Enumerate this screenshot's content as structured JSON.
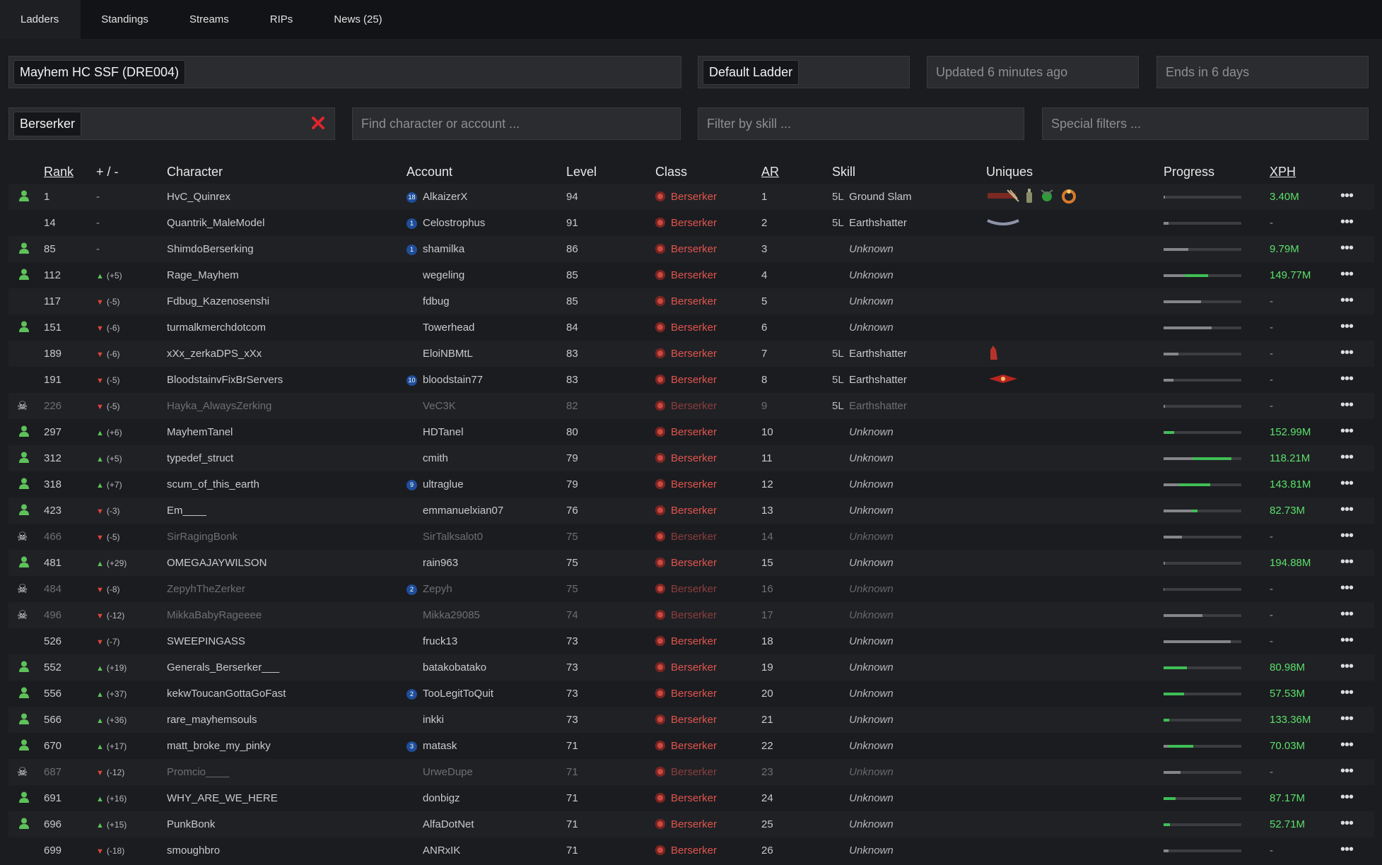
{
  "nav": {
    "tabs": [
      "Ladders",
      "Standings",
      "Streams",
      "RIPs",
      "News (25)"
    ]
  },
  "filters": {
    "league": "Mayhem HC SSF (DRE004)",
    "ladder": "Default Ladder",
    "updated": "Updated 6 minutes ago",
    "ends": "Ends in 6 days",
    "class": "Berserker",
    "search_placeholder": "Find character or account ...",
    "skill_placeholder": "Filter by skill ...",
    "special_placeholder": "Special filters ..."
  },
  "table": {
    "headers": {
      "rank": "Rank",
      "delta": "+ / -",
      "character": "Character",
      "account": "Account",
      "level": "Level",
      "class": "Class",
      "ar": "AR",
      "skill": "Skill",
      "uniques": "Uniques",
      "progress": "Progress",
      "xph": "XPH"
    },
    "rows": [
      {
        "status": "online",
        "rank": "1",
        "dir": "",
        "delta": "-",
        "char": "HvC_Quinrex",
        "charIcon": true,
        "badge": "18",
        "account": "AlkaizerX",
        "level": "94",
        "cls": "Berserker",
        "ar": "1",
        "links": "5L",
        "skill": "Ground Slam",
        "uniques": [
          "belt",
          "flask",
          "amulet",
          "ring"
        ],
        "prev": 0.02,
        "gain": 0.0,
        "xph": "3.40M"
      },
      {
        "status": "",
        "rank": "14",
        "dir": "",
        "delta": "-",
        "char": "Quantrik_MaleModel",
        "charIcon": true,
        "badge": "1",
        "account": "Celostrophus",
        "level": "91",
        "cls": "Berserker",
        "ar": "2",
        "links": "5L",
        "skill": "Earthshatter",
        "uniques": [
          "belt2"
        ],
        "prev": 0.06,
        "gain": 0.0,
        "xph": "-"
      },
      {
        "status": "online",
        "rank": "85",
        "dir": "",
        "delta": "-",
        "char": "ShimdoBerserking",
        "charIcon": false,
        "badge": "1",
        "account": "shamilka",
        "level": "86",
        "cls": "Berserker",
        "ar": "3",
        "links": "",
        "skill": "Unknown",
        "uniques": [],
        "prev": 0.32,
        "gain": 0.0,
        "xph": "9.79M"
      },
      {
        "status": "online",
        "rank": "112",
        "dir": "up",
        "delta": "(+5)",
        "char": "Rage_Mayhem",
        "charIcon": false,
        "badge": "",
        "account": "wegeling",
        "level": "85",
        "cls": "Berserker",
        "ar": "4",
        "links": "",
        "skill": "Unknown",
        "uniques": [],
        "prev": 0.27,
        "gain": 0.3,
        "xph": "149.77M"
      },
      {
        "status": "",
        "rank": "117",
        "dir": "down",
        "delta": "(-5)",
        "char": "Fdbug_Kazenosenshi",
        "charIcon": false,
        "badge": "",
        "account": "fdbug",
        "level": "85",
        "cls": "Berserker",
        "ar": "5",
        "links": "",
        "skill": "Unknown",
        "uniques": [],
        "prev": 0.48,
        "gain": 0.0,
        "xph": "-"
      },
      {
        "status": "online",
        "rank": "151",
        "dir": "down",
        "delta": "(-6)",
        "char": "turmalkmerchdotcom",
        "charIcon": false,
        "badge": "",
        "account": "Towerhead",
        "level": "84",
        "cls": "Berserker",
        "ar": "6",
        "links": "",
        "skill": "Unknown",
        "uniques": [],
        "prev": 0.62,
        "gain": 0.0,
        "xph": "-"
      },
      {
        "status": "",
        "rank": "189",
        "dir": "down",
        "delta": "(-6)",
        "char": "xXx_zerkaDPS_xXx",
        "charIcon": false,
        "badge": "",
        "account": "EloiNBMtL",
        "level": "83",
        "cls": "Berserker",
        "ar": "7",
        "links": "5L",
        "skill": "Earthshatter",
        "uniques": [
          "gloves"
        ],
        "prev": 0.19,
        "gain": 0.0,
        "xph": "-"
      },
      {
        "status": "",
        "rank": "191",
        "dir": "down",
        "delta": "(-5)",
        "char": "BloodstainvFixBrServers",
        "charIcon": false,
        "badge": "10",
        "account": "bloodstain77",
        "level": "83",
        "cls": "Berserker",
        "ar": "8",
        "links": "5L",
        "skill": "Earthshatter",
        "uniques": [
          "belt3"
        ],
        "prev": 0.13,
        "gain": 0.0,
        "xph": "-"
      },
      {
        "status": "dead",
        "rank": "226",
        "dir": "down",
        "delta": "(-5)",
        "char": "Hayka_AlwaysZerking",
        "charIcon": false,
        "badge": "",
        "account": "VeC3K",
        "level": "82",
        "cls": "Berserker",
        "ar": "9",
        "links": "5L",
        "skill": "Earthshatter",
        "uniques": [],
        "prev": 0.02,
        "gain": 0.0,
        "xph": "-"
      },
      {
        "status": "online",
        "rank": "297",
        "dir": "up",
        "delta": "(+6)",
        "char": "MayhemTanel",
        "charIcon": false,
        "badge": "",
        "account": "HDTanel",
        "level": "80",
        "cls": "Berserker",
        "ar": "10",
        "links": "",
        "skill": "Unknown",
        "uniques": [],
        "prev": 0.02,
        "gain": 0.12,
        "xph": "152.99M"
      },
      {
        "status": "online",
        "rank": "312",
        "dir": "up",
        "delta": "(+5)",
        "char": "typedef_struct",
        "charIcon": false,
        "badge": "",
        "account": "cmith",
        "level": "79",
        "cls": "Berserker",
        "ar": "11",
        "links": "",
        "skill": "Unknown",
        "uniques": [],
        "prev": 0.37,
        "gain": 0.5,
        "xph": "118.21M"
      },
      {
        "status": "online",
        "rank": "318",
        "dir": "up",
        "delta": "(+7)",
        "char": "scum_of_this_earth",
        "charIcon": false,
        "badge": "9",
        "account": "ultraglue",
        "level": "79",
        "cls": "Berserker",
        "ar": "12",
        "links": "",
        "skill": "Unknown",
        "uniques": [],
        "prev": 0.2,
        "gain": 0.4,
        "xph": "143.81M"
      },
      {
        "status": "online",
        "rank": "423",
        "dir": "down",
        "delta": "(-3)",
        "char": "Em____",
        "charIcon": false,
        "badge": "",
        "account": "emmanuelxian07",
        "level": "76",
        "cls": "Berserker",
        "ar": "13",
        "links": "",
        "skill": "Unknown",
        "uniques": [],
        "prev": 0.36,
        "gain": 0.08,
        "xph": "82.73M"
      },
      {
        "status": "dead",
        "rank": "466",
        "dir": "down",
        "delta": "(-5)",
        "char": "SirRagingBonk",
        "charIcon": false,
        "badge": "",
        "account": "SirTalksalot0",
        "level": "75",
        "cls": "Berserker",
        "ar": "14",
        "links": "",
        "skill": "Unknown",
        "uniques": [],
        "prev": 0.24,
        "gain": 0.0,
        "xph": "-"
      },
      {
        "status": "online",
        "rank": "481",
        "dir": "up",
        "delta": "(+29)",
        "char": "OMEGAJAYWILSON",
        "charIcon": false,
        "badge": "",
        "account": "rain963",
        "level": "75",
        "cls": "Berserker",
        "ar": "15",
        "links": "",
        "skill": "Unknown",
        "uniques": [],
        "prev": 0.02,
        "gain": 0.0,
        "xph": "194.88M"
      },
      {
        "status": "dead",
        "rank": "484",
        "dir": "down",
        "delta": "(-8)",
        "char": "ZepyhTheZerker",
        "charIcon": false,
        "badge": "2",
        "account": "Zepyh",
        "level": "75",
        "cls": "Berserker",
        "ar": "16",
        "links": "",
        "skill": "Unknown",
        "uniques": [],
        "prev": 0.0,
        "gain": 0.0,
        "xph": "-"
      },
      {
        "status": "dead",
        "rank": "496",
        "dir": "down",
        "delta": "(-12)",
        "char": "MikkaBabyRageeee",
        "charIcon": false,
        "badge": "",
        "account": "Mikka29085",
        "level": "74",
        "cls": "Berserker",
        "ar": "17",
        "links": "",
        "skill": "Unknown",
        "uniques": [],
        "prev": 0.5,
        "gain": 0.0,
        "xph": "-"
      },
      {
        "status": "",
        "rank": "526",
        "dir": "down",
        "delta": "(-7)",
        "char": "SWEEPINGASS",
        "charIcon": false,
        "badge": "",
        "account": "fruck13",
        "level": "73",
        "cls": "Berserker",
        "ar": "18",
        "links": "",
        "skill": "Unknown",
        "uniques": [],
        "prev": 0.86,
        "gain": 0.0,
        "xph": "-"
      },
      {
        "status": "online",
        "rank": "552",
        "dir": "up",
        "delta": "(+19)",
        "char": "Generals_Berserker___",
        "charIcon": false,
        "badge": "",
        "account": "batakobatako",
        "level": "73",
        "cls": "Berserker",
        "ar": "19",
        "links": "",
        "skill": "Unknown",
        "uniques": [],
        "prev": 0.0,
        "gain": 0.3,
        "xph": "80.98M"
      },
      {
        "status": "online",
        "rank": "556",
        "dir": "up",
        "delta": "(+37)",
        "char": "kekwToucanGottaGoFast",
        "charIcon": false,
        "badge": "2",
        "account": "TooLegitToQuit",
        "level": "73",
        "cls": "Berserker",
        "ar": "20",
        "links": "",
        "skill": "Unknown",
        "uniques": [],
        "prev": 0.0,
        "gain": 0.26,
        "xph": "57.53M"
      },
      {
        "status": "online",
        "rank": "566",
        "dir": "up",
        "delta": "(+36)",
        "char": "rare_mayhemsouls",
        "charIcon": false,
        "badge": "",
        "account": "inkki",
        "level": "73",
        "cls": "Berserker",
        "ar": "21",
        "links": "",
        "skill": "Unknown",
        "uniques": [],
        "prev": 0.0,
        "gain": 0.07,
        "xph": "133.36M"
      },
      {
        "status": "online",
        "rank": "670",
        "dir": "up",
        "delta": "(+17)",
        "char": "matt_broke_my_pinky",
        "charIcon": false,
        "badge": "3",
        "account": "matask",
        "level": "71",
        "cls": "Berserker",
        "ar": "22",
        "links": "",
        "skill": "Unknown",
        "uniques": [],
        "prev": 0.06,
        "gain": 0.32,
        "xph": "70.03M"
      },
      {
        "status": "dead",
        "rank": "687",
        "dir": "down",
        "delta": "(-12)",
        "char": "Promcio____",
        "charIcon": false,
        "badge": "",
        "account": "UrweDupe",
        "level": "71",
        "cls": "Berserker",
        "ar": "23",
        "links": "",
        "skill": "Unknown",
        "uniques": [],
        "prev": 0.22,
        "gain": 0.0,
        "xph": "-"
      },
      {
        "status": "online",
        "rank": "691",
        "dir": "up",
        "delta": "(+16)",
        "char": "WHY_ARE_WE_HERE",
        "charIcon": false,
        "badge": "",
        "account": "donbigz",
        "level": "71",
        "cls": "Berserker",
        "ar": "24",
        "links": "",
        "skill": "Unknown",
        "uniques": [],
        "prev": 0.0,
        "gain": 0.15,
        "xph": "87.17M"
      },
      {
        "status": "online",
        "rank": "696",
        "dir": "up",
        "delta": "(+15)",
        "char": "PunkBonk",
        "charIcon": false,
        "badge": "",
        "account": "AlfaDotNet",
        "level": "71",
        "cls": "Berserker",
        "ar": "25",
        "links": "",
        "skill": "Unknown",
        "uniques": [],
        "prev": 0.0,
        "gain": 0.08,
        "xph": "52.71M"
      },
      {
        "status": "",
        "rank": "699",
        "dir": "down",
        "delta": "(-18)",
        "char": "smoughbro",
        "charIcon": false,
        "badge": "",
        "account": "ANRxIK",
        "level": "71",
        "cls": "Berserker",
        "ar": "26",
        "links": "",
        "skill": "Unknown",
        "uniques": [],
        "prev": 0.06,
        "gain": 0.0,
        "xph": "-"
      }
    ]
  },
  "colors": {
    "up": "#5ec25a",
    "down": "#e0443c",
    "xph": "#5ce06a",
    "class": "#e0554d",
    "progress_gain": "#3fbf55"
  }
}
